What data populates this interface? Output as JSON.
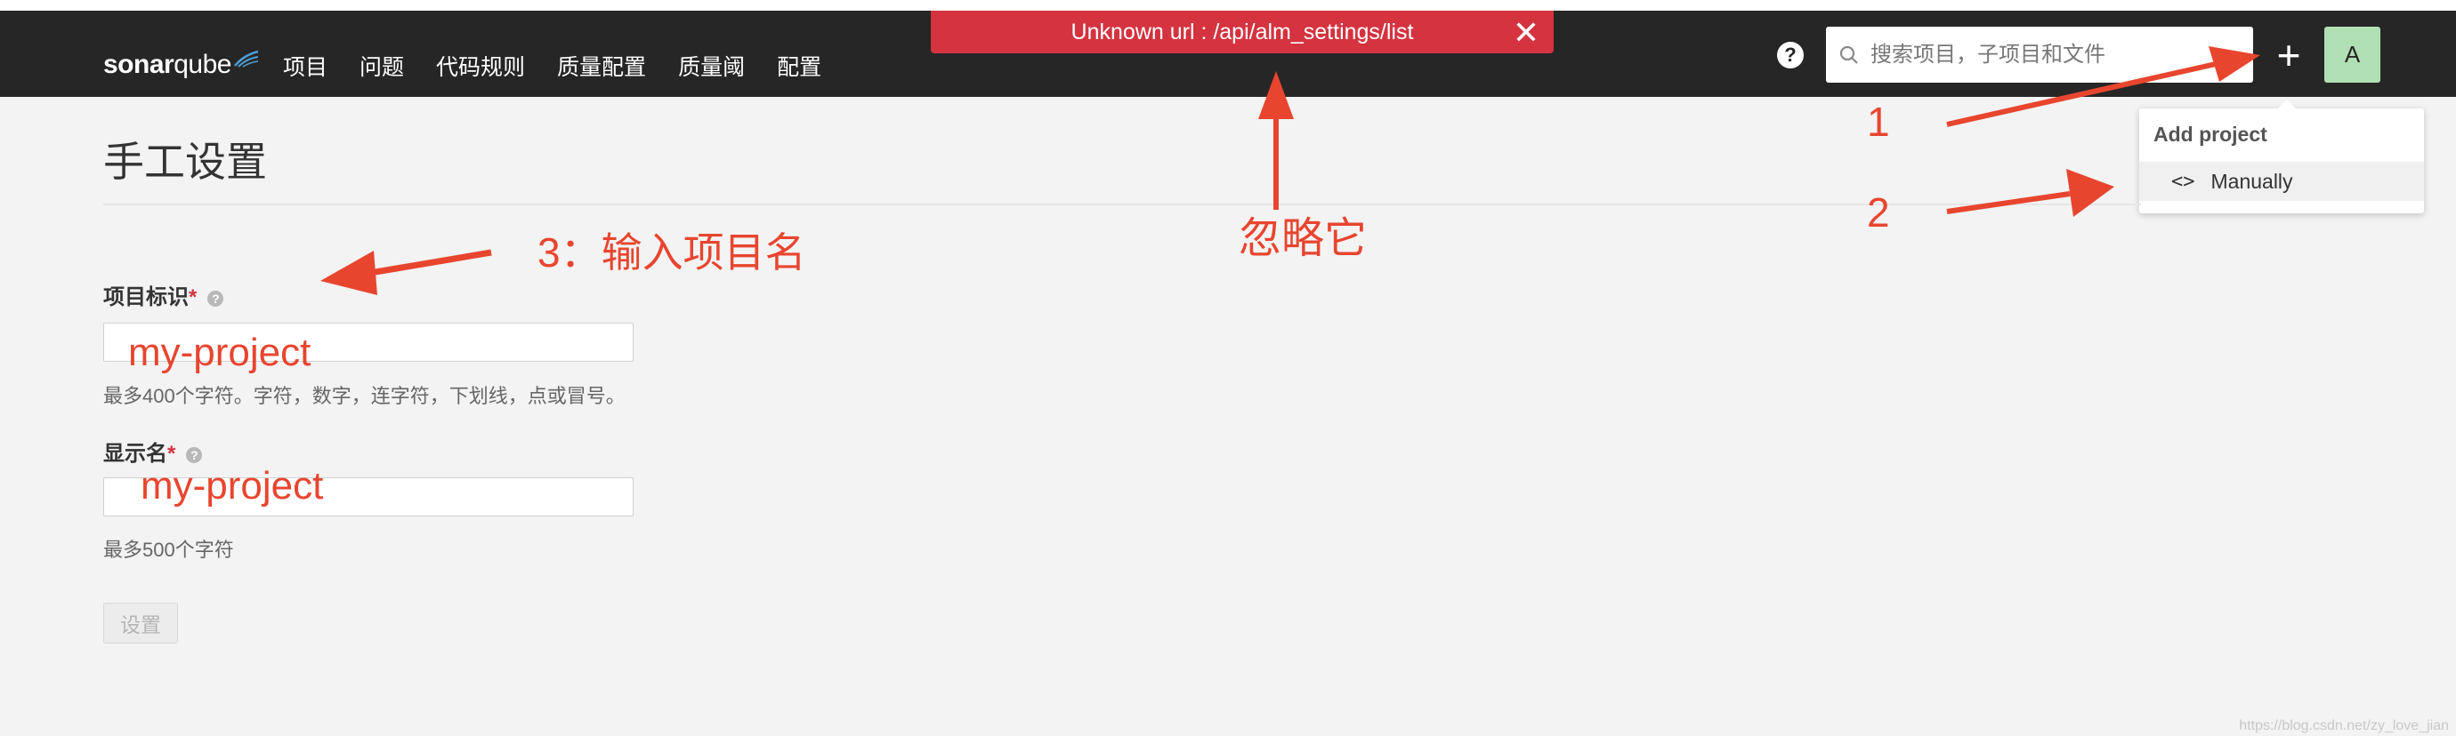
{
  "navbar": {
    "logo_bold": "sonar",
    "logo_light": "qube",
    "items": [
      "项目",
      "问题",
      "代码规则",
      "质量配置",
      "质量阈",
      "配置"
    ],
    "search_placeholder": "搜索项目，子项目和文件",
    "avatar_initial": "A",
    "help_label": "?"
  },
  "error_toast": {
    "message": "Unknown url : /api/alm_settings/list",
    "close": "✕"
  },
  "add_project_menu": {
    "header": "Add project",
    "code_icon": "<>",
    "item_manually": "Manually"
  },
  "form": {
    "title": "手工设置",
    "project_key_label": "项目标识",
    "project_key_hint": "最多400个字符。字符，数字，连字符，下划线，点或冒号。",
    "display_name_label": "显示名",
    "display_name_hint": "最多500个字符",
    "required_mark": "*",
    "submit": "设置"
  },
  "annotations": {
    "step1": "1",
    "step2": "2",
    "step3": "3：输入项目名",
    "ignore": "忽略它",
    "project_key_value": "my-project",
    "display_name_value": "my-project"
  },
  "watermark": "https://blog.csdn.net/zy_love_jian"
}
